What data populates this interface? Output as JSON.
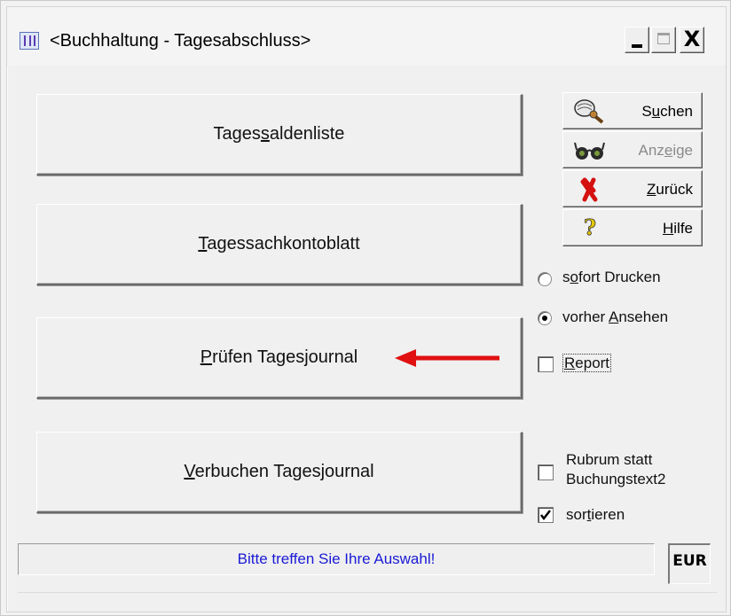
{
  "window": {
    "title": "<Buchhaltung - Tagesabschluss>",
    "controls": {
      "minimize": "_",
      "maximize": "□",
      "close": "X"
    }
  },
  "main_buttons": [
    {
      "pre": "Tages",
      "u": "s",
      "post": "aldenliste"
    },
    {
      "pre": "",
      "u": "T",
      "post": "agessachkontoblatt"
    },
    {
      "pre": "",
      "u": "P",
      "post": "rüfen Tagesjournal"
    },
    {
      "pre": "",
      "u": "V",
      "post": "erbuchen Tagesjournal"
    }
  ],
  "side_buttons": [
    {
      "pre": "S",
      "u": "u",
      "post": "chen",
      "icon": "search-icon",
      "disabled": false
    },
    {
      "pre": "Anz",
      "u": "e",
      "post": "ige",
      "icon": "glasses-icon",
      "disabled": true
    },
    {
      "pre": "",
      "u": "Z",
      "post": "urück",
      "icon": "red-x-icon",
      "disabled": false
    },
    {
      "pre": "",
      "u": "H",
      "post": "ilfe",
      "icon": "help-icon",
      "disabled": false
    }
  ],
  "print_options": {
    "sofort": {
      "pre": "s",
      "u": "o",
      "post": "fort Drucken",
      "selected": false
    },
    "vorher": {
      "pre": "vorher ",
      "u": "A",
      "post": "nsehen",
      "selected": true
    }
  },
  "report": {
    "pre": "",
    "u": "R",
    "post": "eport",
    "checked": false
  },
  "rubrum": {
    "line1": "Rubrum statt",
    "line2": "Buchungstext2",
    "checked": false
  },
  "sortieren": {
    "pre": "sor",
    "u": "t",
    "post": "ieren",
    "checked": true
  },
  "status_message": "Bitte treffen Sie Ihre Auswahl!",
  "currency": "EUR",
  "colors": {
    "status_text": "#1a1ad6",
    "arrow": "#e01010"
  }
}
